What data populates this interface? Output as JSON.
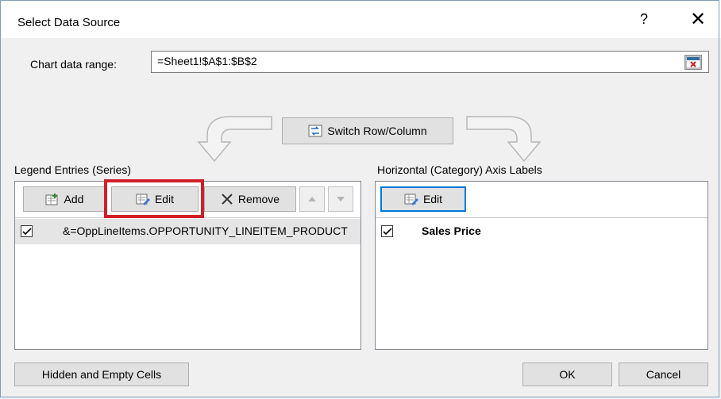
{
  "dialog": {
    "title": "Select Data Source",
    "help": "?",
    "close": "✕"
  },
  "range": {
    "label": "Chart data range:",
    "value": "=Sheet1!$A$1:$B$2"
  },
  "switch_button": "Switch Row/Column",
  "legend": {
    "label": "Legend Entries (Series)",
    "buttons": {
      "add": "Add",
      "edit": "Edit",
      "remove": "Remove"
    },
    "items": [
      {
        "label": "&=OppLineItems.OPPORTUNITY_LINEITEM_PRODUCT",
        "checked": true
      }
    ]
  },
  "axis": {
    "label": "Horizontal (Category) Axis Labels",
    "buttons": {
      "edit": "Edit"
    },
    "items": [
      {
        "label": "Sales Price",
        "checked": true
      }
    ]
  },
  "footer": {
    "hidden_empty": "Hidden and Empty Cells",
    "ok": "OK",
    "cancel": "Cancel"
  },
  "colors": {
    "highlight": "#d11f27",
    "focus": "#0078d7"
  },
  "icons": [
    "range-select-icon",
    "switch-icon",
    "add-icon",
    "edit-icon",
    "remove-icon",
    "up-arrow-icon",
    "down-arrow-icon",
    "checkbox-icon"
  ]
}
